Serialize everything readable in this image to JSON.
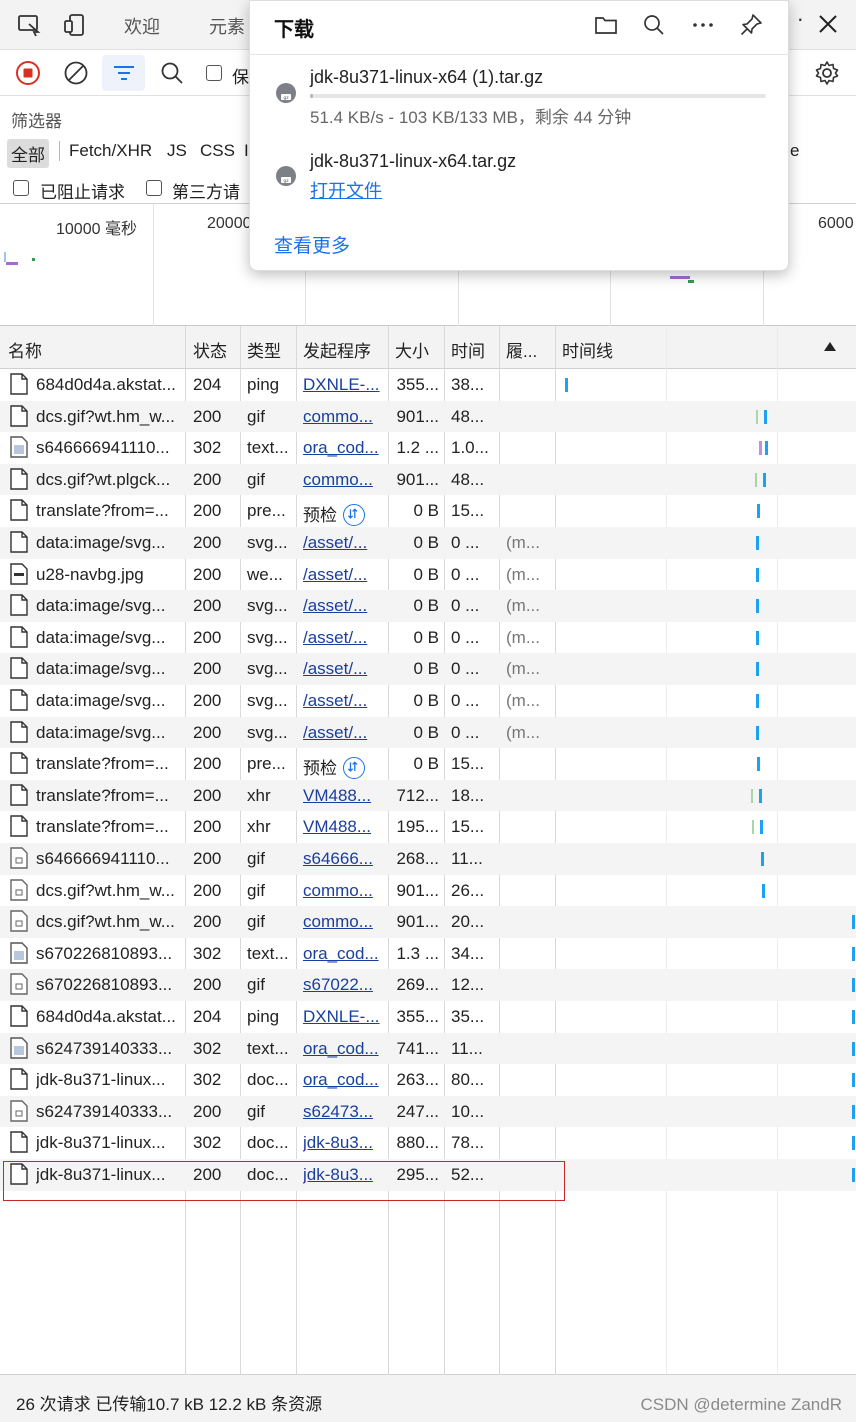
{
  "tabbar": {
    "tabs": [
      "欢迎",
      "元素"
    ]
  },
  "toolbar": {
    "keep_label": "保"
  },
  "filter": {
    "label": "筛选器",
    "types": [
      "全部",
      "Fetch/XHR",
      "JS",
      "CSS",
      "I"
    ],
    "trailing_type": "e",
    "blocked_label": "已阻止请求",
    "third_party_label": "第三方请"
  },
  "overview": {
    "ticks": [
      "10000 毫秒",
      "20000",
      "6000"
    ]
  },
  "table": {
    "headers": {
      "name": "名称",
      "status": "状态",
      "type": "类型",
      "initiator": "发起程序",
      "size": "大小",
      "time": "时间",
      "fulfilled": "履...",
      "waterfall": "时间线"
    },
    "rows": [
      {
        "name": "684d0d4a.akstat...",
        "status": "204",
        "type": "ping",
        "initiator": "DXNLE-...",
        "size": "355...",
        "time": "38...",
        "fulfilled": "",
        "icon": "document-icon"
      },
      {
        "name": "dcs.gif?wt.hm_w...",
        "status": "200",
        "type": "gif",
        "initiator": "commo...",
        "size": "901...",
        "time": "48...",
        "fulfilled": "",
        "icon": "document-icon"
      },
      {
        "name": "s646666941110...",
        "status": "302",
        "type": "text...",
        "initiator": "ora_cod...",
        "size": "1.2 ...",
        "time": "1.0...",
        "fulfilled": "",
        "icon": "image-file-icon"
      },
      {
        "name": "dcs.gif?wt.plgck...",
        "status": "200",
        "type": "gif",
        "initiator": "commo...",
        "size": "901...",
        "time": "48...",
        "fulfilled": "",
        "icon": "document-icon"
      },
      {
        "name": "translate?from=...",
        "status": "200",
        "type": "pre...",
        "initiator": "预检",
        "size": "0 B",
        "time": "15...",
        "fulfilled": "",
        "icon": "document-icon",
        "preflight": true
      },
      {
        "name": "data:image/svg...",
        "status": "200",
        "type": "svg...",
        "initiator": "/asset/...",
        "size": "0 B",
        "time": "0 ...",
        "fulfilled": "(m...",
        "icon": "document-icon"
      },
      {
        "name": "u28-navbg.jpg",
        "status": "200",
        "type": "we...",
        "initiator": "/asset/...",
        "size": "0 B",
        "time": "0 ...",
        "fulfilled": "(m...",
        "icon": "image-icon"
      },
      {
        "name": "data:image/svg...",
        "status": "200",
        "type": "svg...",
        "initiator": "/asset/...",
        "size": "0 B",
        "time": "0 ...",
        "fulfilled": "(m...",
        "icon": "document-icon"
      },
      {
        "name": "data:image/svg...",
        "status": "200",
        "type": "svg...",
        "initiator": "/asset/...",
        "size": "0 B",
        "time": "0 ...",
        "fulfilled": "(m...",
        "icon": "document-icon"
      },
      {
        "name": "data:image/svg...",
        "status": "200",
        "type": "svg...",
        "initiator": "/asset/...",
        "size": "0 B",
        "time": "0 ...",
        "fulfilled": "(m...",
        "icon": "document-icon"
      },
      {
        "name": "data:image/svg...",
        "status": "200",
        "type": "svg...",
        "initiator": "/asset/...",
        "size": "0 B",
        "time": "0 ...",
        "fulfilled": "(m...",
        "icon": "document-icon"
      },
      {
        "name": "data:image/svg...",
        "status": "200",
        "type": "svg...",
        "initiator": "/asset/...",
        "size": "0 B",
        "time": "0 ...",
        "fulfilled": "(m...",
        "icon": "document-icon"
      },
      {
        "name": "translate?from=...",
        "status": "200",
        "type": "pre...",
        "initiator": "预检",
        "size": "0 B",
        "time": "15...",
        "fulfilled": "",
        "icon": "document-icon",
        "preflight": true
      },
      {
        "name": "translate?from=...",
        "status": "200",
        "type": "xhr",
        "initiator": "VM488...",
        "size": "712...",
        "time": "18...",
        "fulfilled": "",
        "icon": "document-icon"
      },
      {
        "name": "translate?from=...",
        "status": "200",
        "type": "xhr",
        "initiator": "VM488...",
        "size": "195...",
        "time": "15...",
        "fulfilled": "",
        "icon": "document-icon"
      },
      {
        "name": "s646666941110...",
        "status": "200",
        "type": "gif",
        "initiator": "s64666...",
        "size": "268...",
        "time": "11...",
        "fulfilled": "",
        "icon": "small-file-icon"
      },
      {
        "name": "dcs.gif?wt.hm_w...",
        "status": "200",
        "type": "gif",
        "initiator": "commo...",
        "size": "901...",
        "time": "26...",
        "fulfilled": "",
        "icon": "small-file-icon"
      },
      {
        "name": "dcs.gif?wt.hm_w...",
        "status": "200",
        "type": "gif",
        "initiator": "commo...",
        "size": "901...",
        "time": "20...",
        "fulfilled": "",
        "icon": "small-file-icon"
      },
      {
        "name": "s670226810893...",
        "status": "302",
        "type": "text...",
        "initiator": "ora_cod...",
        "size": "1.3 ...",
        "time": "34...",
        "fulfilled": "",
        "icon": "image-file-icon"
      },
      {
        "name": "s670226810893...",
        "status": "200",
        "type": "gif",
        "initiator": "s67022...",
        "size": "269...",
        "time": "12...",
        "fulfilled": "",
        "icon": "small-file-icon"
      },
      {
        "name": "684d0d4a.akstat...",
        "status": "204",
        "type": "ping",
        "initiator": "DXNLE-...",
        "size": "355...",
        "time": "35...",
        "fulfilled": "",
        "icon": "document-icon"
      },
      {
        "name": "s624739140333...",
        "status": "302",
        "type": "text...",
        "initiator": "ora_cod...",
        "size": "741...",
        "time": "11...",
        "fulfilled": "",
        "icon": "image-file-icon"
      },
      {
        "name": "jdk-8u371-linux...",
        "status": "302",
        "type": "doc...",
        "initiator": "ora_cod...",
        "size": "263...",
        "time": "80...",
        "fulfilled": "",
        "icon": "document-icon"
      },
      {
        "name": "s624739140333...",
        "status": "200",
        "type": "gif",
        "initiator": "s62473...",
        "size": "247...",
        "time": "10...",
        "fulfilled": "",
        "icon": "small-file-icon"
      },
      {
        "name": "jdk-8u371-linux...",
        "status": "302",
        "type": "doc...",
        "initiator": "jdk-8u3...",
        "size": "880...",
        "time": "78...",
        "fulfilled": "",
        "icon": "document-icon"
      },
      {
        "name": "jdk-8u371-linux...",
        "status": "200",
        "type": "doc...",
        "initiator": "jdk-8u3...",
        "size": "295...",
        "time": "52...",
        "fulfilled": "",
        "icon": "document-icon"
      }
    ]
  },
  "status_bar": {
    "text": "26 次请求  已传输10.7 kB  12.2 kB 条资源",
    "watermark": "CSDN @determine ZandR"
  },
  "downloads": {
    "title": "下载",
    "items": [
      {
        "name": "jdk-8u371-linux-x64 (1).tar.gz",
        "status": "51.4 KB/s - 103 KB/133 MB，剩余 44 分钟",
        "progress": 0.0008
      },
      {
        "name": "jdk-8u371-linux-x64.tar.gz",
        "action": "打开文件"
      }
    ],
    "see_more": "查看更多"
  },
  "colors": {
    "accent": "#1a73e8",
    "record_red": "#d93025",
    "link": "#1a3e9e",
    "highlight_border": "#c62828"
  }
}
